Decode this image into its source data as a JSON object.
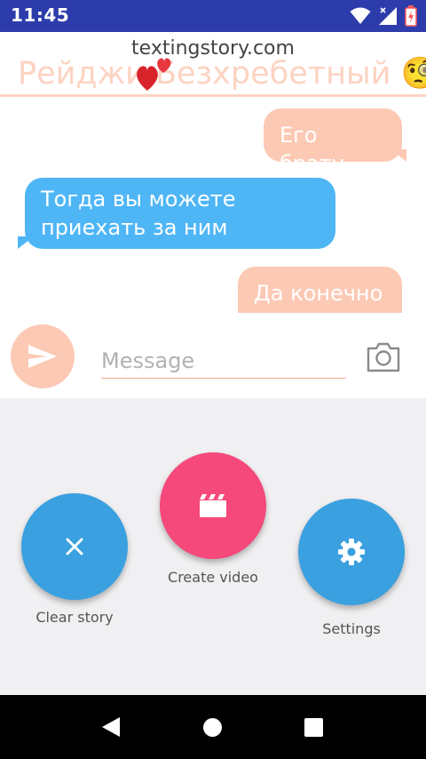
{
  "status_bar": {
    "time": "11:45",
    "icons": [
      "wifi-icon",
      "cellular-signal-icon",
      "battery-charging-icon"
    ]
  },
  "header": {
    "watermark": "textingstory.com",
    "contact_name": "Рейджи Безхребетный",
    "contact_emoji": "🧐",
    "sticker_icon": "hearts-icon"
  },
  "messages": [
    {
      "side": "right",
      "text": "Его брату"
    },
    {
      "side": "left",
      "text": "Тогда вы можете приехать за ним"
    },
    {
      "side": "right",
      "text": "Да конечно"
    }
  ],
  "composer": {
    "placeholder": "Message",
    "send_icon": "send-icon",
    "camera_icon": "camera-icon"
  },
  "actions": {
    "clear": {
      "label": "Clear story",
      "icon": "close-icon"
    },
    "create": {
      "label": "Create video",
      "icon": "movie-clapper-icon"
    },
    "settings": {
      "label": "Settings",
      "icon": "gear-icon"
    }
  },
  "colors": {
    "status_bar": "#2d3cab",
    "outgoing_bubble": "#fcc9b4",
    "incoming_bubble": "#4fb6f6",
    "fab_blue": "#3aa0e0",
    "fab_pink": "#f5487b",
    "panel_bg": "#f0eff1"
  },
  "nav_bar": [
    "back-icon",
    "home-icon",
    "recents-icon"
  ]
}
